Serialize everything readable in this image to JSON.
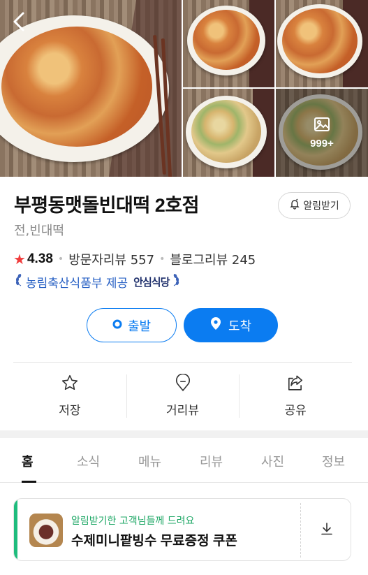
{
  "photos": {
    "more_count": "999+"
  },
  "place": {
    "name": "부평동맷돌빈대떡 2호점",
    "category": "전,빈대떡",
    "notify_label": "알림받기",
    "rating": "4.38",
    "visitor_reviews": "방문자리뷰 557",
    "blog_reviews": "블로그리뷰 245",
    "badge_text": "농림축산식품부 제공",
    "badge_brand": "안심식당"
  },
  "route": {
    "depart_label": "출발",
    "arrive_label": "도착"
  },
  "actions": [
    {
      "label": "저장"
    },
    {
      "label": "거리뷰"
    },
    {
      "label": "공유"
    }
  ],
  "tabs": [
    {
      "label": "홈",
      "active": true
    },
    {
      "label": "소식"
    },
    {
      "label": "메뉴"
    },
    {
      "label": "리뷰"
    },
    {
      "label": "사진"
    },
    {
      "label": "정보"
    }
  ],
  "coupon": {
    "subtitle": "알림받기한 고객님들께 드려요",
    "title": "수제미니팥빙수 무료증정 쿠폰"
  },
  "colors": {
    "accent_blue": "#0b7cf1",
    "coupon_green": "#1ebc7d",
    "star_red": "#f03c3c"
  }
}
